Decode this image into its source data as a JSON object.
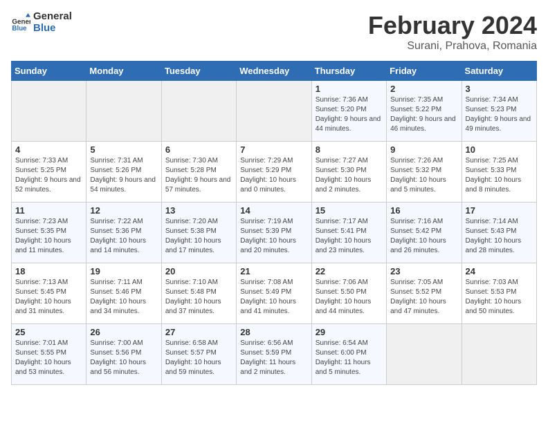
{
  "logo": {
    "text_general": "General",
    "text_blue": "Blue"
  },
  "title": "February 2024",
  "subtitle": "Surani, Prahova, Romania",
  "weekdays": [
    "Sunday",
    "Monday",
    "Tuesday",
    "Wednesday",
    "Thursday",
    "Friday",
    "Saturday"
  ],
  "weeks": [
    [
      {
        "day": "",
        "sunrise": "",
        "sunset": "",
        "daylight": "",
        "empty": true
      },
      {
        "day": "",
        "sunrise": "",
        "sunset": "",
        "daylight": "",
        "empty": true
      },
      {
        "day": "",
        "sunrise": "",
        "sunset": "",
        "daylight": "",
        "empty": true
      },
      {
        "day": "",
        "sunrise": "",
        "sunset": "",
        "daylight": "",
        "empty": true
      },
      {
        "day": "1",
        "sunrise": "Sunrise: 7:36 AM",
        "sunset": "Sunset: 5:20 PM",
        "daylight": "Daylight: 9 hours and 44 minutes."
      },
      {
        "day": "2",
        "sunrise": "Sunrise: 7:35 AM",
        "sunset": "Sunset: 5:22 PM",
        "daylight": "Daylight: 9 hours and 46 minutes."
      },
      {
        "day": "3",
        "sunrise": "Sunrise: 7:34 AM",
        "sunset": "Sunset: 5:23 PM",
        "daylight": "Daylight: 9 hours and 49 minutes."
      }
    ],
    [
      {
        "day": "4",
        "sunrise": "Sunrise: 7:33 AM",
        "sunset": "Sunset: 5:25 PM",
        "daylight": "Daylight: 9 hours and 52 minutes."
      },
      {
        "day": "5",
        "sunrise": "Sunrise: 7:31 AM",
        "sunset": "Sunset: 5:26 PM",
        "daylight": "Daylight: 9 hours and 54 minutes."
      },
      {
        "day": "6",
        "sunrise": "Sunrise: 7:30 AM",
        "sunset": "Sunset: 5:28 PM",
        "daylight": "Daylight: 9 hours and 57 minutes."
      },
      {
        "day": "7",
        "sunrise": "Sunrise: 7:29 AM",
        "sunset": "Sunset: 5:29 PM",
        "daylight": "Daylight: 10 hours and 0 minutes."
      },
      {
        "day": "8",
        "sunrise": "Sunrise: 7:27 AM",
        "sunset": "Sunset: 5:30 PM",
        "daylight": "Daylight: 10 hours and 2 minutes."
      },
      {
        "day": "9",
        "sunrise": "Sunrise: 7:26 AM",
        "sunset": "Sunset: 5:32 PM",
        "daylight": "Daylight: 10 hours and 5 minutes."
      },
      {
        "day": "10",
        "sunrise": "Sunrise: 7:25 AM",
        "sunset": "Sunset: 5:33 PM",
        "daylight": "Daylight: 10 hours and 8 minutes."
      }
    ],
    [
      {
        "day": "11",
        "sunrise": "Sunrise: 7:23 AM",
        "sunset": "Sunset: 5:35 PM",
        "daylight": "Daylight: 10 hours and 11 minutes."
      },
      {
        "day": "12",
        "sunrise": "Sunrise: 7:22 AM",
        "sunset": "Sunset: 5:36 PM",
        "daylight": "Daylight: 10 hours and 14 minutes."
      },
      {
        "day": "13",
        "sunrise": "Sunrise: 7:20 AM",
        "sunset": "Sunset: 5:38 PM",
        "daylight": "Daylight: 10 hours and 17 minutes."
      },
      {
        "day": "14",
        "sunrise": "Sunrise: 7:19 AM",
        "sunset": "Sunset: 5:39 PM",
        "daylight": "Daylight: 10 hours and 20 minutes."
      },
      {
        "day": "15",
        "sunrise": "Sunrise: 7:17 AM",
        "sunset": "Sunset: 5:41 PM",
        "daylight": "Daylight: 10 hours and 23 minutes."
      },
      {
        "day": "16",
        "sunrise": "Sunrise: 7:16 AM",
        "sunset": "Sunset: 5:42 PM",
        "daylight": "Daylight: 10 hours and 26 minutes."
      },
      {
        "day": "17",
        "sunrise": "Sunrise: 7:14 AM",
        "sunset": "Sunset: 5:43 PM",
        "daylight": "Daylight: 10 hours and 28 minutes."
      }
    ],
    [
      {
        "day": "18",
        "sunrise": "Sunrise: 7:13 AM",
        "sunset": "Sunset: 5:45 PM",
        "daylight": "Daylight: 10 hours and 31 minutes."
      },
      {
        "day": "19",
        "sunrise": "Sunrise: 7:11 AM",
        "sunset": "Sunset: 5:46 PM",
        "daylight": "Daylight: 10 hours and 34 minutes."
      },
      {
        "day": "20",
        "sunrise": "Sunrise: 7:10 AM",
        "sunset": "Sunset: 5:48 PM",
        "daylight": "Daylight: 10 hours and 37 minutes."
      },
      {
        "day": "21",
        "sunrise": "Sunrise: 7:08 AM",
        "sunset": "Sunset: 5:49 PM",
        "daylight": "Daylight: 10 hours and 41 minutes."
      },
      {
        "day": "22",
        "sunrise": "Sunrise: 7:06 AM",
        "sunset": "Sunset: 5:50 PM",
        "daylight": "Daylight: 10 hours and 44 minutes."
      },
      {
        "day": "23",
        "sunrise": "Sunrise: 7:05 AM",
        "sunset": "Sunset: 5:52 PM",
        "daylight": "Daylight: 10 hours and 47 minutes."
      },
      {
        "day": "24",
        "sunrise": "Sunrise: 7:03 AM",
        "sunset": "Sunset: 5:53 PM",
        "daylight": "Daylight: 10 hours and 50 minutes."
      }
    ],
    [
      {
        "day": "25",
        "sunrise": "Sunrise: 7:01 AM",
        "sunset": "Sunset: 5:55 PM",
        "daylight": "Daylight: 10 hours and 53 minutes."
      },
      {
        "day": "26",
        "sunrise": "Sunrise: 7:00 AM",
        "sunset": "Sunset: 5:56 PM",
        "daylight": "Daylight: 10 hours and 56 minutes."
      },
      {
        "day": "27",
        "sunrise": "Sunrise: 6:58 AM",
        "sunset": "Sunset: 5:57 PM",
        "daylight": "Daylight: 10 hours and 59 minutes."
      },
      {
        "day": "28",
        "sunrise": "Sunrise: 6:56 AM",
        "sunset": "Sunset: 5:59 PM",
        "daylight": "Daylight: 11 hours and 2 minutes."
      },
      {
        "day": "29",
        "sunrise": "Sunrise: 6:54 AM",
        "sunset": "Sunset: 6:00 PM",
        "daylight": "Daylight: 11 hours and 5 minutes."
      },
      {
        "day": "",
        "sunrise": "",
        "sunset": "",
        "daylight": "",
        "empty": true
      },
      {
        "day": "",
        "sunrise": "",
        "sunset": "",
        "daylight": "",
        "empty": true
      }
    ]
  ]
}
